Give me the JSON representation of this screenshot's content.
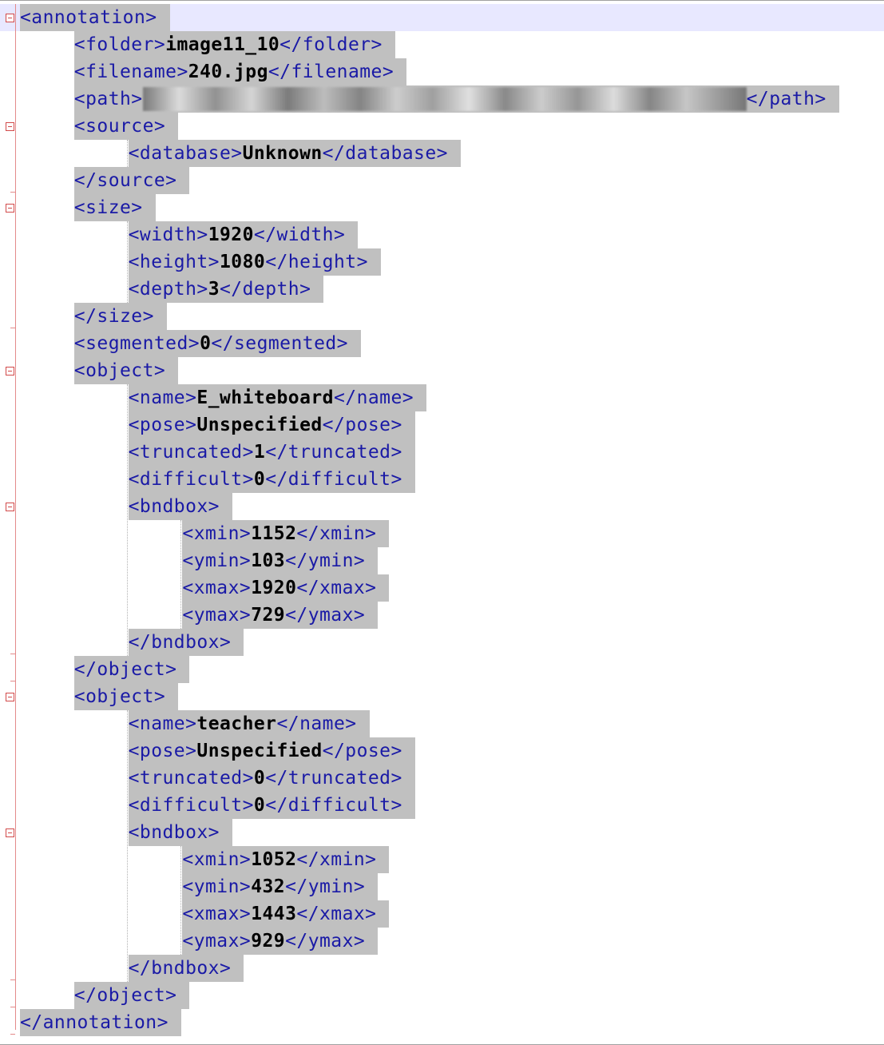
{
  "xml_lines": [
    {
      "indent": 0,
      "open": "<annotation>",
      "value": null,
      "close": ""
    },
    {
      "indent": 1,
      "open": "<folder>",
      "value": "image11_10",
      "close": "</folder>"
    },
    {
      "indent": 1,
      "open": "<filename>",
      "value": "240.jpg",
      "close": "</filename>"
    },
    {
      "indent": 1,
      "open": "<path>",
      "value": "",
      "redacted": true,
      "close": "</path>"
    },
    {
      "indent": 1,
      "open": "<source>",
      "value": null,
      "close": ""
    },
    {
      "indent": 2,
      "open": "<database>",
      "value": "Unknown",
      "close": "</database>"
    },
    {
      "indent": 1,
      "open": "</source>",
      "value": null,
      "close": ""
    },
    {
      "indent": 1,
      "open": "<size>",
      "value": null,
      "close": ""
    },
    {
      "indent": 2,
      "open": "<width>",
      "value": "1920",
      "close": "</width>"
    },
    {
      "indent": 2,
      "open": "<height>",
      "value": "1080",
      "close": "</height>"
    },
    {
      "indent": 2,
      "open": "<depth>",
      "value": "3",
      "close": "</depth>"
    },
    {
      "indent": 1,
      "open": "</size>",
      "value": null,
      "close": ""
    },
    {
      "indent": 1,
      "open": "<segmented>",
      "value": "0",
      "close": "</segmented>"
    },
    {
      "indent": 1,
      "open": "<object>",
      "value": null,
      "close": ""
    },
    {
      "indent": 2,
      "open": "<name>",
      "value": "E_whiteboard",
      "close": "</name>"
    },
    {
      "indent": 2,
      "open": "<pose>",
      "value": "Unspecified",
      "close": "</pose>"
    },
    {
      "indent": 2,
      "open": "<truncated>",
      "value": "1",
      "close": "</truncated>"
    },
    {
      "indent": 2,
      "open": "<difficult>",
      "value": "0",
      "close": "</difficult>"
    },
    {
      "indent": 2,
      "open": "<bndbox>",
      "value": null,
      "close": ""
    },
    {
      "indent": 3,
      "open": "<xmin>",
      "value": "1152",
      "close": "</xmin>"
    },
    {
      "indent": 3,
      "open": "<ymin>",
      "value": "103",
      "close": "</ymin>"
    },
    {
      "indent": 3,
      "open": "<xmax>",
      "value": "1920",
      "close": "</xmax>"
    },
    {
      "indent": 3,
      "open": "<ymax>",
      "value": "729",
      "close": "</ymax>"
    },
    {
      "indent": 2,
      "open": "</bndbox>",
      "value": null,
      "close": ""
    },
    {
      "indent": 1,
      "open": "</object>",
      "value": null,
      "close": ""
    },
    {
      "indent": 1,
      "open": "<object>",
      "value": null,
      "close": ""
    },
    {
      "indent": 2,
      "open": "<name>",
      "value": "teacher",
      "close": "</name>"
    },
    {
      "indent": 2,
      "open": "<pose>",
      "value": "Unspecified",
      "close": "</pose>"
    },
    {
      "indent": 2,
      "open": "<truncated>",
      "value": "0",
      "close": "</truncated>"
    },
    {
      "indent": 2,
      "open": "<difficult>",
      "value": "0",
      "close": "</difficult>"
    },
    {
      "indent": 2,
      "open": "<bndbox>",
      "value": null,
      "close": ""
    },
    {
      "indent": 3,
      "open": "<xmin>",
      "value": "1052",
      "close": "</xmin>"
    },
    {
      "indent": 3,
      "open": "<ymin>",
      "value": "432",
      "close": "</ymin>"
    },
    {
      "indent": 3,
      "open": "<xmax>",
      "value": "1443",
      "close": "</xmax>"
    },
    {
      "indent": 3,
      "open": "<ymax>",
      "value": "929",
      "close": "</ymax>"
    },
    {
      "indent": 2,
      "open": "</bndbox>",
      "value": null,
      "close": ""
    },
    {
      "indent": 1,
      "open": "</object>",
      "value": null,
      "close": ""
    },
    {
      "indent": 0,
      "open": "</annotation>",
      "value": null,
      "close": ""
    }
  ],
  "fold_markers": [
    "<annotation>",
    "<source>",
    "<size>",
    "<object>",
    "<bndbox>",
    "<object>",
    "<bndbox>"
  ],
  "colors": {
    "tag": "#1a1aa6",
    "value": "#000000",
    "selection": "#c0c0c0",
    "current_line": "#e8e8ff",
    "fold": "#d24a4a"
  }
}
